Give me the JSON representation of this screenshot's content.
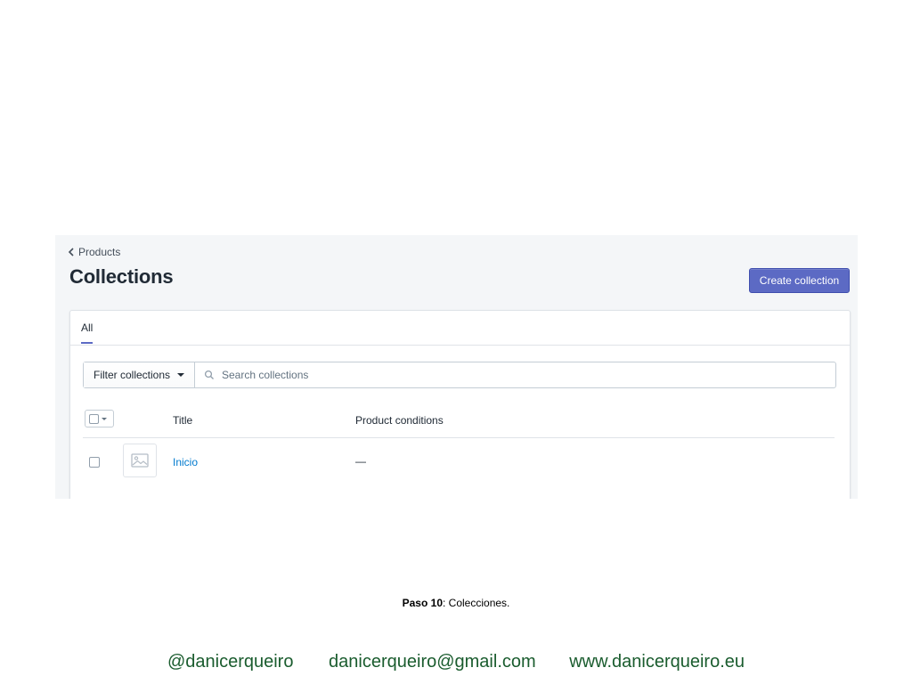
{
  "breadcrumb": {
    "label": "Products"
  },
  "header": {
    "title": "Collections",
    "primary_action": "Create collection"
  },
  "tabs": [
    {
      "label": "All",
      "selected": true
    }
  ],
  "filter": {
    "button_label": "Filter collections",
    "search_placeholder": "Search collections",
    "search_value": ""
  },
  "table": {
    "columns": [
      "Title",
      "Product conditions"
    ],
    "rows": [
      {
        "title": "Inicio",
        "conditions": "—"
      }
    ]
  },
  "caption": {
    "step": "Paso 10",
    "text": ": Colecciones."
  },
  "footer": {
    "twitter": "@danicerqueiro",
    "email": "danicerqueiro@gmail.com",
    "website": "www.danicerqueiro.eu"
  },
  "colors": {
    "accent": "#5c6ac4",
    "link": "#007ace",
    "background": "#f4f6f8",
    "footer_text": "#1a5c2e"
  },
  "icons": [
    "chevron-left-icon",
    "caret-down-icon",
    "search-icon",
    "image-placeholder-icon"
  ]
}
